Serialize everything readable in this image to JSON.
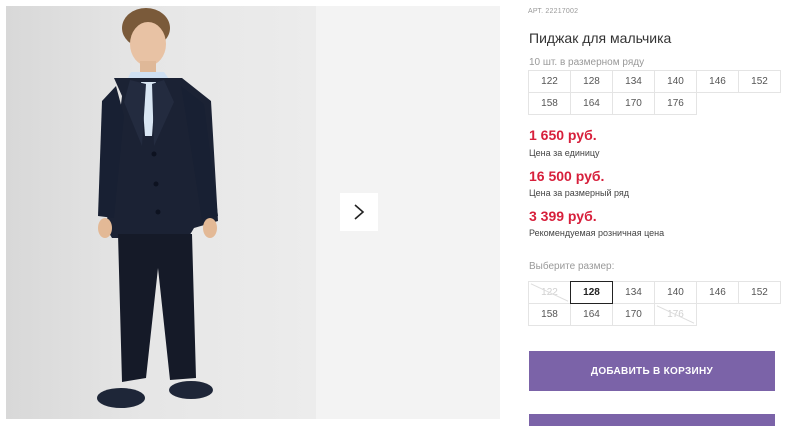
{
  "product": {
    "sku_label": "АРТ. 22217002",
    "title": "Пиджак для мальчика",
    "pack_note": "10 шт. в размерном ряду",
    "pack_sizes": [
      "122",
      "128",
      "134",
      "140",
      "146",
      "152",
      "158",
      "164",
      "170",
      "176"
    ],
    "prices": [
      {
        "value": "1 650 руб.",
        "label": "Цена за единицу"
      },
      {
        "value": "16 500 руб.",
        "label": "Цена за размерный ряд"
      },
      {
        "value": "3 399 руб.",
        "label": "Рекомендуемая розничная цена"
      }
    ],
    "choose_size_label": "Выберите размер:",
    "select_sizes": [
      {
        "label": "122",
        "state": "disabled"
      },
      {
        "label": "128",
        "state": "selected"
      },
      {
        "label": "134",
        "state": "available"
      },
      {
        "label": "140",
        "state": "available"
      },
      {
        "label": "146",
        "state": "available"
      },
      {
        "label": "152",
        "state": "available"
      },
      {
        "label": "158",
        "state": "available"
      },
      {
        "label": "164",
        "state": "available"
      },
      {
        "label": "170",
        "state": "available"
      },
      {
        "label": "176",
        "state": "disabled"
      }
    ],
    "add_to_cart": "ДОБАВИТЬ В КОРЗИНУ"
  },
  "colors": {
    "accent": "#7b63a8",
    "price": "#d71f3b"
  },
  "icons": {
    "next": "chevron-right-icon"
  }
}
